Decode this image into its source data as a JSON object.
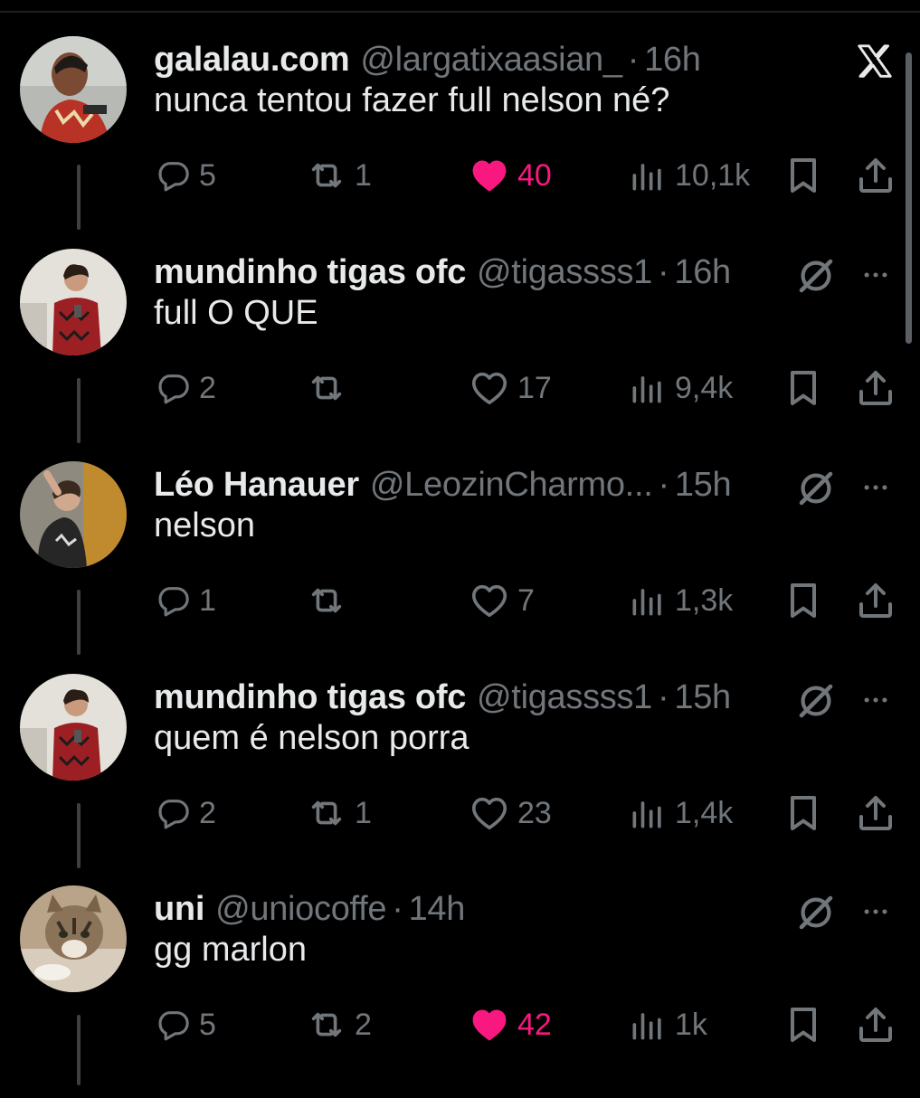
{
  "colors": {
    "background": "#000000",
    "text": "#e7e9ea",
    "muted": "#71767b",
    "like_active": "#f91880",
    "thread_line": "#3e4144"
  },
  "tweets": [
    {
      "name": "galalau.com",
      "handle": "@largatixaasian_",
      "separator": "·",
      "time": "16h",
      "text": "nunca tentou fazer full nelson né?",
      "replies": "5",
      "retweets": "1",
      "likes": "40",
      "views": "10,1k",
      "liked": true,
      "corner_icon": "x-logo-icon"
    },
    {
      "name": "mundinho tigas ofc",
      "handle": "@tigassss1",
      "separator": "·",
      "time": "16h",
      "text": "full O QUE",
      "replies": "2",
      "retweets": "",
      "likes": "17",
      "views": "9,4k",
      "liked": false,
      "corner_icon": "mute-icon"
    },
    {
      "name": "Léo Hanauer",
      "handle": "@LeozinCharmo...",
      "separator": "·",
      "time": "15h",
      "text": "nelson",
      "replies": "1",
      "retweets": "",
      "likes": "7",
      "views": "1,3k",
      "liked": false,
      "corner_icon": "mute-icon"
    },
    {
      "name": "mundinho tigas ofc",
      "handle": "@tigassss1",
      "separator": "·",
      "time": "15h",
      "text": "quem é nelson porra",
      "replies": "2",
      "retweets": "1",
      "likes": "23",
      "views": "1,4k",
      "liked": false,
      "corner_icon": "mute-icon"
    },
    {
      "name": "uni",
      "handle": "@uniocoffe",
      "separator": "·",
      "time": "14h",
      "text": "gg marlon",
      "replies": "5",
      "retweets": "2",
      "likes": "42",
      "views": "1k",
      "liked": true,
      "corner_icon": "mute-icon"
    }
  ]
}
